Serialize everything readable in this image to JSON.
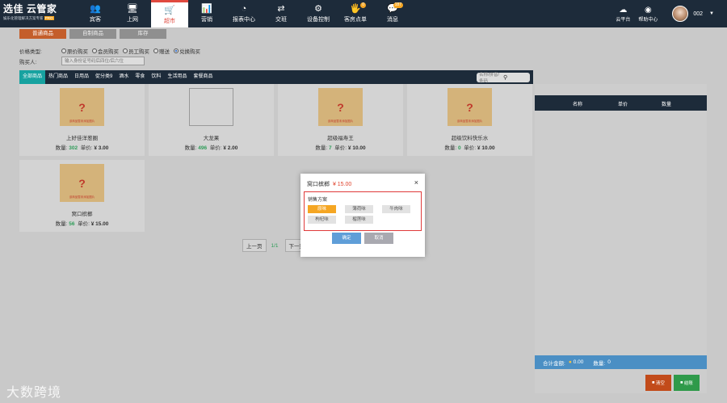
{
  "brand": {
    "title": "选佳 云管家",
    "subtitle": "娱乐化管理解决方案专家",
    "tag": "PRO"
  },
  "nav": [
    {
      "label": "宾客",
      "icon": "👥"
    },
    {
      "label": "上网",
      "icon": "🖥"
    },
    {
      "label": "超市",
      "icon": "🛒"
    },
    {
      "label": "营销",
      "icon": "📊"
    },
    {
      "label": "报表中心",
      "icon": "◔"
    },
    {
      "label": "交班",
      "icon": "⇄"
    },
    {
      "label": "设备控制",
      "icon": "⚙"
    },
    {
      "label": "客房点单",
      "icon": "🖐",
      "badge": "0"
    },
    {
      "label": "消息",
      "icon": "💬",
      "badge": "187"
    }
  ],
  "top_right": [
    {
      "label": "云平台",
      "icon": "☁"
    },
    {
      "label": "帮助中心",
      "icon": "◉"
    }
  ],
  "user": {
    "name": "002",
    "caret": "▼"
  },
  "subtabs": [
    "普通商品",
    "自制商品",
    "库存"
  ],
  "price_type": {
    "label": "价格类型:",
    "options": [
      "原价购买",
      "会员购买",
      "员工购买",
      "赠送",
      "兑换购买"
    ],
    "selected_index": 4
  },
  "buyer": {
    "label": "购买人:",
    "placeholder": "输入身份证号码后四位/后六位"
  },
  "categories": [
    "全部商品",
    "热门商品",
    "日用品",
    "促分类9",
    "酒水",
    "零食",
    "饮料",
    "生活用品",
    "套餐商品"
  ],
  "search": {
    "placeholder": "名称/拼音/条码",
    "icon": "search-icon"
  },
  "products": [
    {
      "name": "上好佳洋葱圈",
      "qty": "302",
      "price": "¥ 3.00",
      "image": true
    },
    {
      "name": "大龙果",
      "qty": "496",
      "price": "¥ 2.00",
      "image": false
    },
    {
      "name": "超级福寿王",
      "qty": "7",
      "price": "¥ 10.00",
      "image": true
    },
    {
      "name": "超级饮料快乐水",
      "qty": "0",
      "price": "¥ 10.00",
      "image": true
    },
    {
      "name": "窝口槟榔",
      "qty": "56",
      "price": "¥ 15.00",
      "image": true
    }
  ],
  "product_labels": {
    "qty": "数量:",
    "price": "单价:",
    "placeholder_caption": "该商品暂未添加图片"
  },
  "pager": {
    "prev": "上一页",
    "current": "1/1",
    "next": "下一页"
  },
  "cart": {
    "columns": [
      "名称",
      "单价",
      "数量"
    ],
    "total_label": "合计金额:",
    "total_value": "0.00",
    "qty_label": "数量:",
    "qty_value": "0",
    "btn_clear": "清空",
    "btn_pay": "结账"
  },
  "modal": {
    "title": "窝口槟榔",
    "price": "¥ 15.00",
    "close": "×",
    "group_label": "销售方案",
    "options": [
      "原味",
      "薄荷味",
      "牛肉味",
      "枸杞味",
      "榴莲味"
    ],
    "selected_index": 0,
    "ok": "确定",
    "cancel": "取消"
  },
  "watermark": "大数跨境"
}
